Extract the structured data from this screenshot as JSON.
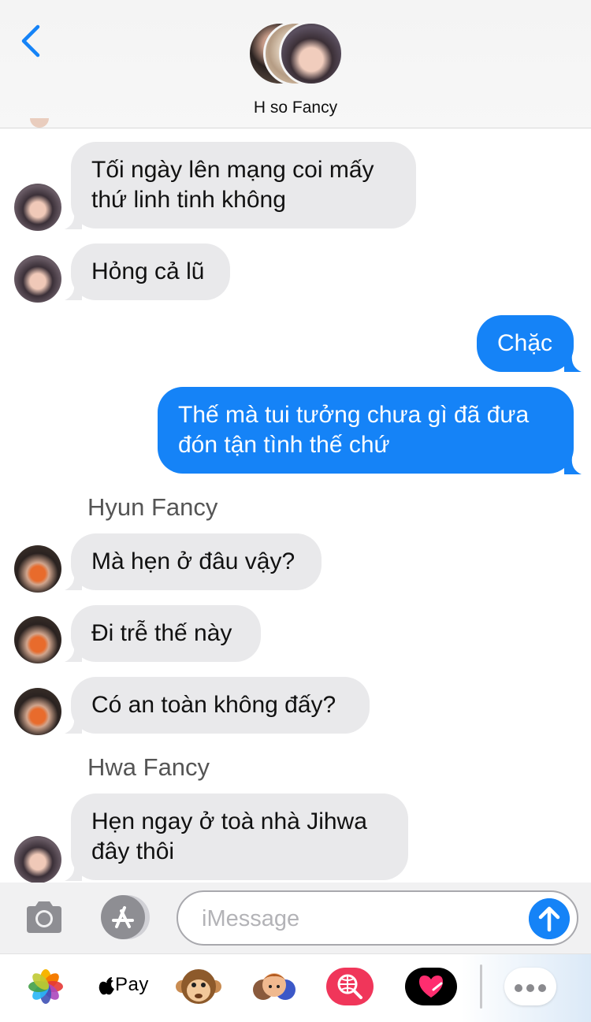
{
  "header": {
    "title": "H so Fancy"
  },
  "messages": [
    {
      "text_lines": [
        "Tối ngày lên mạng coi mấy",
        "thứ linh tinh không"
      ]
    },
    {
      "text": "Hỏng cả lũ"
    },
    {
      "text": "Chặc"
    },
    {
      "text_lines": [
        "Thế mà tui tưởng chưa gì đã đưa",
        "đón tận tình thế chứ"
      ]
    },
    {
      "text": "Mà hẹn ở đâu vậy?"
    },
    {
      "text": "Đi trễ thế này"
    },
    {
      "text": "Có an toàn không đấy?"
    },
    {
      "text_lines": [
        "Hẹn ngay ở toà nhà Jihwa",
        "đây thôi"
      ]
    }
  ],
  "senders": {
    "hyun": "Hyun Fancy",
    "hwa": "Hwa Fancy"
  },
  "composer": {
    "placeholder": "iMessage"
  },
  "app_drawer": {
    "apple_pay_label": "Pay"
  },
  "colors": {
    "outgoing_bubble": "#1583f7",
    "incoming_bubble": "#e9e9eb",
    "accent": "#1583f7"
  },
  "icons": [
    "back-chevron-icon",
    "camera-icon",
    "app-store-icon",
    "send-arrow-icon",
    "photos-icon",
    "apple-logo-icon",
    "monkey-animoji-icon",
    "memoji-icon",
    "web-search-icon",
    "digital-touch-icon",
    "more-icon"
  ]
}
